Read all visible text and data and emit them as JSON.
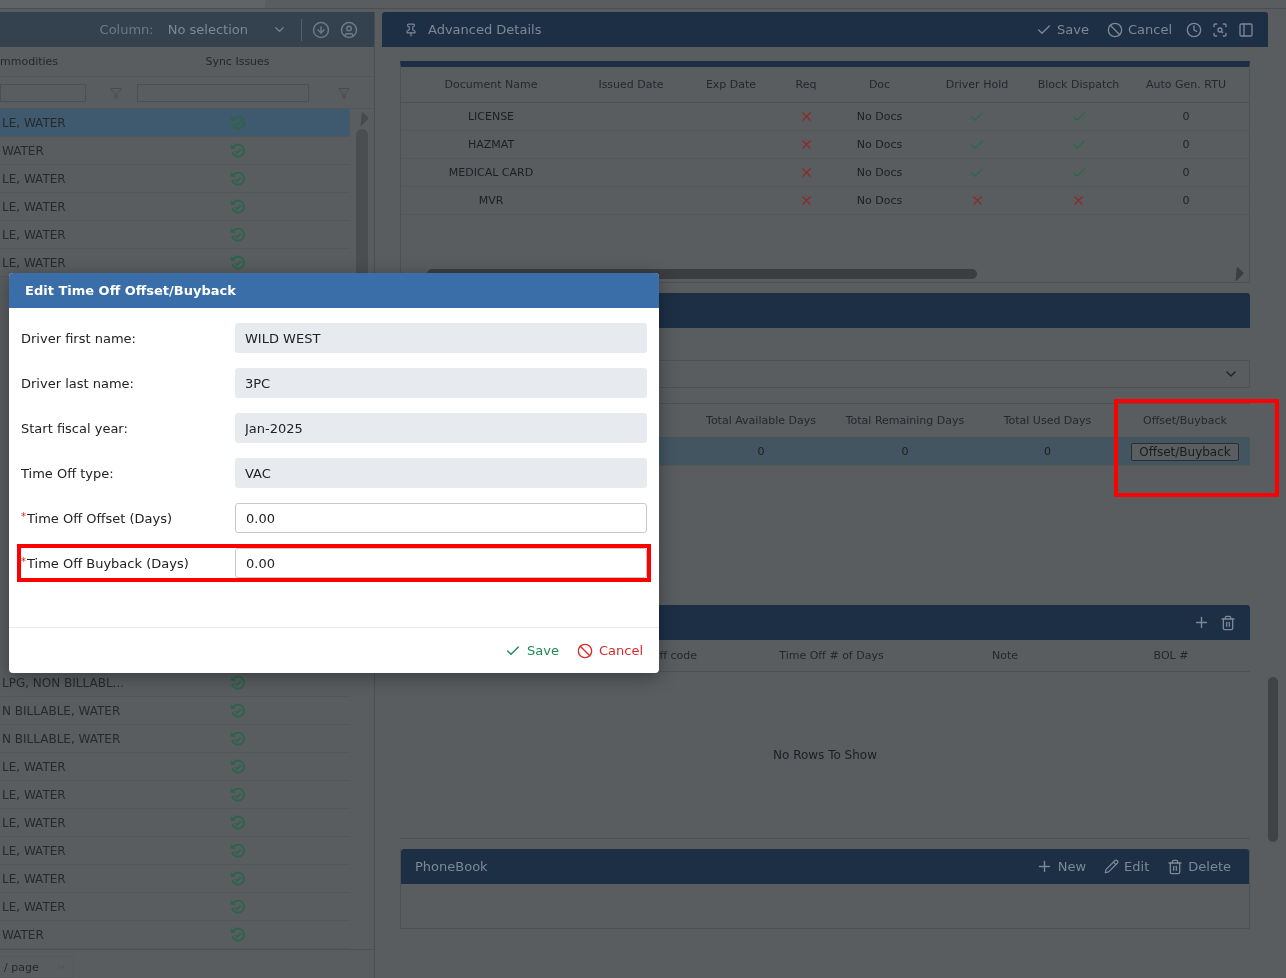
{
  "commodities_panel": {
    "column_label": "Column:",
    "column_value": "No selection",
    "columns": [
      "mmodities",
      "Sync Issues"
    ],
    "rows_top": [
      {
        "commodities": "LE, WATER",
        "selected": true
      },
      {
        "commodities": "WATER",
        "selected": false
      },
      {
        "commodities": "LE, WATER",
        "selected": false
      },
      {
        "commodities": "LE, WATER",
        "selected": false
      },
      {
        "commodities": "LE, WATER",
        "selected": false
      },
      {
        "commodities": "LE, WATER",
        "selected": false
      }
    ],
    "rows_bottom": [
      {
        "commodities": "LPG, NON BILLABL...",
        "selected": false
      },
      {
        "commodities": "N BILLABLE, WATER",
        "selected": false
      },
      {
        "commodities": "N BILLABLE, WATER",
        "selected": false
      },
      {
        "commodities": "LE, WATER",
        "selected": false
      },
      {
        "commodities": "LE, WATER",
        "selected": false
      },
      {
        "commodities": "LE, WATER",
        "selected": false
      },
      {
        "commodities": "LE, WATER",
        "selected": false
      },
      {
        "commodities": "LE, WATER",
        "selected": false
      },
      {
        "commodities": "LE, WATER",
        "selected": false
      },
      {
        "commodities": "WATER",
        "selected": false
      }
    ],
    "page_size": "/ page"
  },
  "details_panel": {
    "title": "Advanced Details",
    "actions": [
      {
        "kind": "save",
        "label": "Save"
      },
      {
        "kind": "cancel",
        "label": "Cancel"
      }
    ],
    "documents": {
      "columns": [
        "Document Name",
        "Issued Date",
        "Exp Date",
        "Req",
        "Doc",
        "Driver Hold",
        "Block Dispatch",
        "Auto Gen. RTU"
      ],
      "rows": [
        {
          "name": "LICENSE",
          "req": false,
          "doc": "No Docs",
          "driver_hold": true,
          "block_dispatch": true,
          "auto_gen_rtu": "0"
        },
        {
          "name": "HAZMAT",
          "req": false,
          "doc": "No Docs",
          "driver_hold": true,
          "block_dispatch": true,
          "auto_gen_rtu": "0"
        },
        {
          "name": "MEDICAL CARD",
          "req": false,
          "doc": "No Docs",
          "driver_hold": true,
          "block_dispatch": true,
          "auto_gen_rtu": "0"
        },
        {
          "name": "MVR",
          "req": false,
          "doc": "No Docs",
          "driver_hold": false,
          "block_dispatch": false,
          "auto_gen_rtu": "0"
        }
      ]
    }
  },
  "time_off_panel": {
    "columns": [
      "Total Available Days",
      "Total Remaining Days",
      "Total Used Days",
      "Offset/Buyback"
    ],
    "offset_column_highlighted": true,
    "rows": [
      {
        "available": "0",
        "remaining": "0",
        "used": "0",
        "action": "Offset/Buyback",
        "selected": true
      }
    ]
  },
  "history_panel": {
    "columns": [
      "ff code",
      "Time Off # of Days",
      "Note",
      "BOL #"
    ],
    "empty_text": "No Rows To Show"
  },
  "phonebook_panel": {
    "title": "PhoneBook",
    "actions": [
      {
        "kind": "new",
        "label": "New"
      },
      {
        "kind": "edit",
        "label": "Edit"
      },
      {
        "kind": "delete",
        "label": "Delete"
      }
    ]
  },
  "dialog": {
    "title": "Edit Time Off Offset/Buyback",
    "fields": [
      {
        "label": "Driver first name:",
        "value": "WILD WEST",
        "disabled": true,
        "highlighted": false
      },
      {
        "label": "Driver last name:",
        "value": "3PC",
        "disabled": true,
        "highlighted": false
      },
      {
        "label": "Start fiscal year:",
        "value": "Jan-2025",
        "disabled": true,
        "highlighted": false
      },
      {
        "label": "Time Off type:",
        "value": "VAC",
        "disabled": true,
        "highlighted": false
      },
      {
        "label": "Time Off Offset (Days)",
        "value": "0.00",
        "required_mark": "*",
        "disabled": false,
        "highlighted": false
      },
      {
        "label": "Time Off Buyback (Days)",
        "value": "0.00",
        "required_mark": "*",
        "disabled": false,
        "highlighted": true
      }
    ],
    "actions": [
      {
        "kind": "save",
        "label": "Save"
      },
      {
        "kind": "cancel",
        "label": "Cancel"
      }
    ]
  }
}
